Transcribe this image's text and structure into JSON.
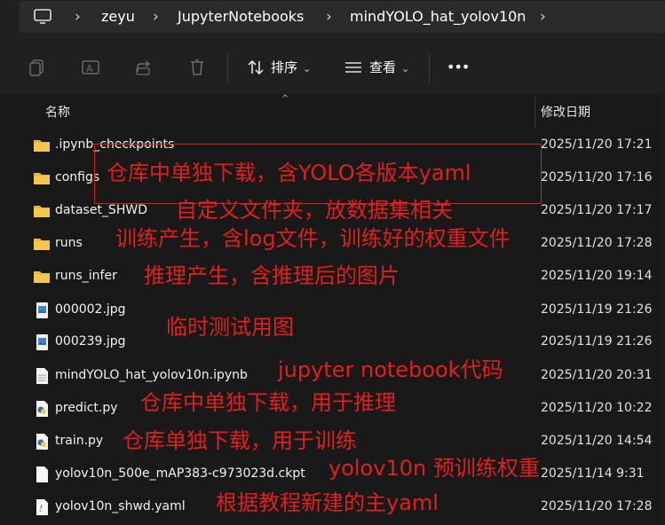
{
  "address_bar": {
    "crumbs": [
      "zeyu",
      "JupyterNotebooks",
      "mindYOLO_hat_yolov10n"
    ]
  },
  "toolbar": {
    "sort_label": "排序",
    "view_label": "查看",
    "more_label": "•••"
  },
  "columns": {
    "name": "名称",
    "date": "修改日期"
  },
  "files": [
    {
      "name": ".ipynb_checkpoints",
      "date": "2025/11/20 17:21",
      "type": "folder"
    },
    {
      "name": "configs",
      "date": "2025/11/20 17:16",
      "type": "folder"
    },
    {
      "name": "dataset_SHWD",
      "date": "2025/11/20 17:17",
      "type": "folder"
    },
    {
      "name": "runs",
      "date": "2025/11/20 17:28",
      "type": "folder"
    },
    {
      "name": "runs_infer",
      "date": "2025/11/20 19:14",
      "type": "folder"
    },
    {
      "name": "000002.jpg",
      "date": "2025/11/19 21:26",
      "type": "image"
    },
    {
      "name": "000239.jpg",
      "date": "2025/11/19 21:26",
      "type": "image"
    },
    {
      "name": "mindYOLO_hat_yolov10n.ipynb",
      "date": "2025/11/20 20:31",
      "type": "document"
    },
    {
      "name": "predict.py",
      "date": "2025/11/20 10:22",
      "type": "python"
    },
    {
      "name": "train.py",
      "date": "2025/11/20 14:54",
      "type": "python"
    },
    {
      "name": "yolov10n_500e_mAP383-c973023d.ckpt",
      "date": "2025/11/14 9:31",
      "type": "document"
    },
    {
      "name": "yolov10n_shwd.yaml",
      "date": "2025/11/20 17:28",
      "type": "yaml"
    }
  ],
  "annotations": [
    "仓库中单独下载，含YOLO各版本yaml",
    "自定义文件夹，放数据集相关",
    "训练产生，含log文件，训练好的权重文件",
    "推理产生，含推理后的图片",
    "临时测试用图",
    "jupyter notebook代码",
    "仓库中单独下载，用于推理",
    "仓库单独下载，用于训练",
    "yolov10n 预训练权重",
    "根据教程新建的主yaml"
  ],
  "colors": {
    "annotation": "#e0201f",
    "folder": "#e8b53a",
    "background": "#191919"
  }
}
